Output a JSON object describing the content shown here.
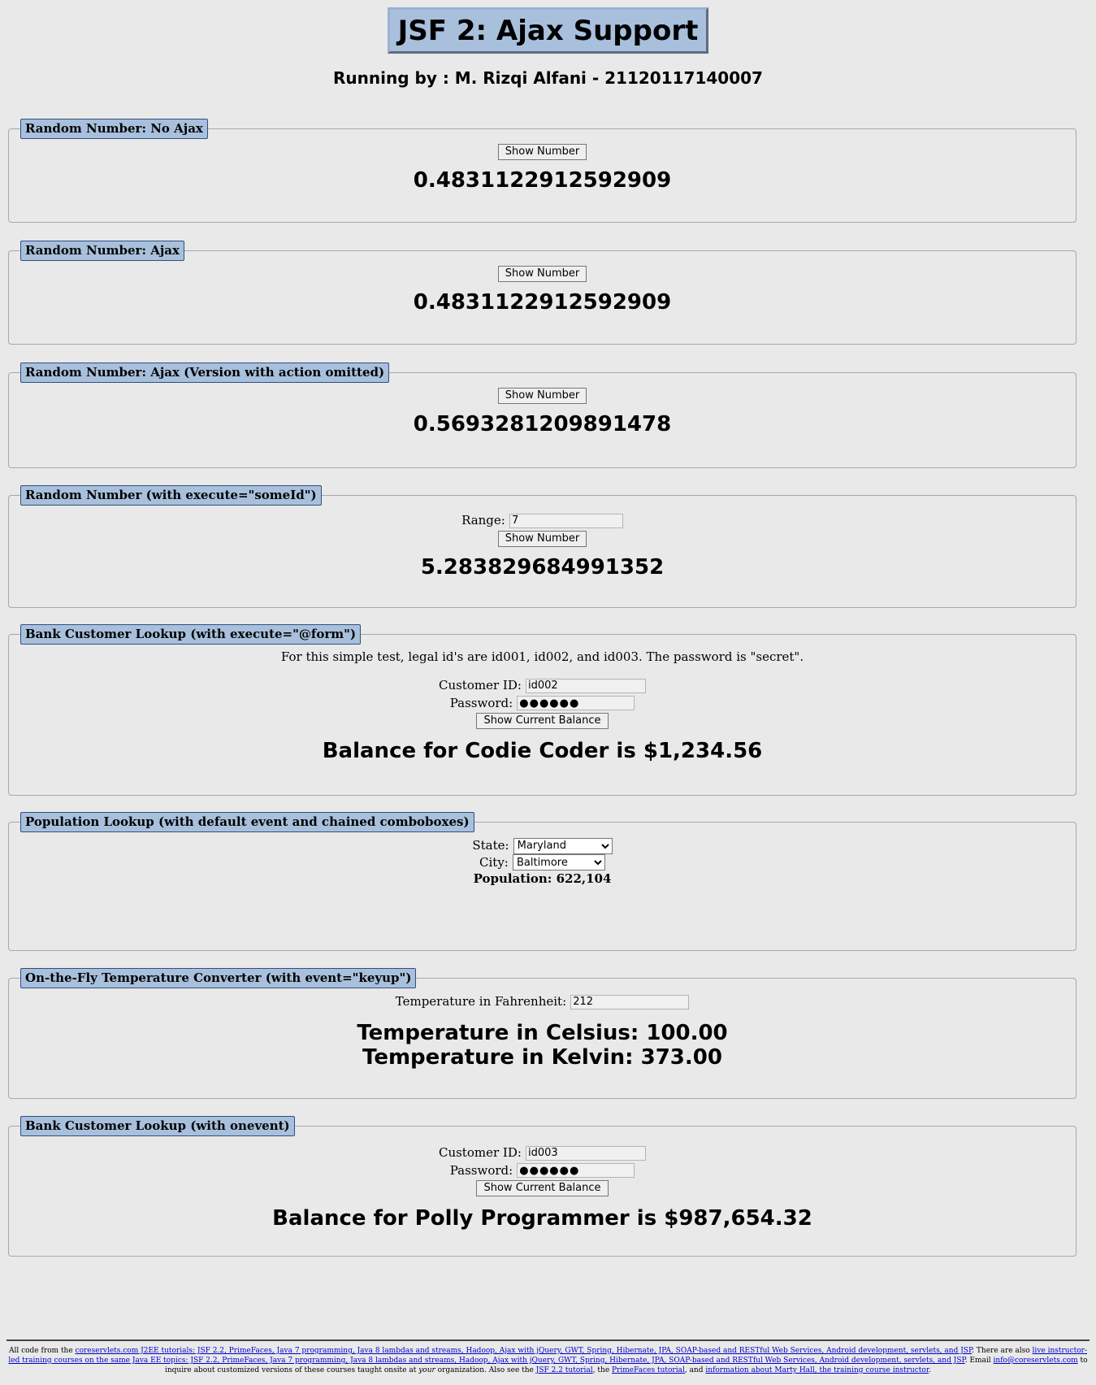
{
  "page": {
    "title": "JSF 2: Ajax Support",
    "subtitle": "Running by : M. Rizqi Alfani - 21120117140007"
  },
  "sections": {
    "no_ajax": {
      "legend": "Random Number: No Ajax",
      "button": "Show Number",
      "result": "0.4831122912592909"
    },
    "ajax": {
      "legend": "Random Number: Ajax",
      "button": "Show Number",
      "result": "0.4831122912592909"
    },
    "ajax_omitted": {
      "legend": "Random Number: Ajax (Version with action omitted)",
      "button": "Show Number",
      "result": "0.5693281209891478"
    },
    "execute_id": {
      "legend": "Random Number (with execute=\"someId\")",
      "range_label": "Range:",
      "range_value": "7",
      "button": "Show Number",
      "result": "5.283829684991352"
    },
    "bank_form": {
      "legend": "Bank Customer Lookup (with execute=\"@form\")",
      "note": "For this simple test, legal id's are id001, id002, and id003. The password is \"secret\".",
      "customer_label": "Customer ID:",
      "customer_value": "id002",
      "password_label": "Password:",
      "password_value": "●●●●●●",
      "button": "Show Current Balance",
      "result": "Balance for Codie Coder is $1,234.56"
    },
    "population": {
      "legend": "Population Lookup (with default event and chained comboboxes)",
      "state_label": "State:",
      "state_value": "Maryland",
      "city_label": "City:",
      "city_value": "Baltimore",
      "population_text": "Population: 622,104"
    },
    "temperature": {
      "legend": "On-the-Fly Temperature Converter (with event=\"keyup\")",
      "fahrenheit_label": "Temperature in Fahrenheit:",
      "fahrenheit_value": "212",
      "celsius_text": "Temperature in Celsius: 100.00",
      "kelvin_text": "Temperature in Kelvin: 373.00"
    },
    "bank_onevent": {
      "legend": "Bank Customer Lookup (with onevent)",
      "customer_label": "Customer ID:",
      "customer_value": "id003",
      "password_label": "Password:",
      "password_value": "●●●●●●",
      "button": "Show Current Balance",
      "result": "Balance for Polly Programmer is $987,654.32"
    }
  },
  "footer": {
    "prefix": "All code from the ",
    "link1": "coreservlets.com J2EE tutorials: JSF 2.2, PrimeFaces, Java 7 programming, Java 8 lambdas and streams, Hadoop, Ajax with jQuery, GWT, Spring, Hibernate, JPA, SOAP-based and RESTful Web Services, Android development, servlets, and JSP",
    "mid1": ". There are also ",
    "link2": "live instructor-led training courses on the same Java EE topics: JSF 2.2, PrimeFaces, Java 7 programming, Java 8 lambdas and streams, Hadoop, Ajax with jQuery, GWT, Spring, Hibernate, JPA, SOAP-based and RESTful Web Services, Android development, servlets, and JSP",
    "mid2": ". Email ",
    "link3": "info@coreservlets.com",
    "mid3": " to inquire about customized versions of these courses taught onsite at ",
    "your": "your",
    "mid4": " organization. Also see the ",
    "link4": "JSF 2.2 tutorial",
    "mid5": ", the ",
    "link5": "PrimeFaces tutorial",
    "mid6": ", and ",
    "link6": "information about Marty Hall, the training course instructor",
    "suffix": "."
  }
}
